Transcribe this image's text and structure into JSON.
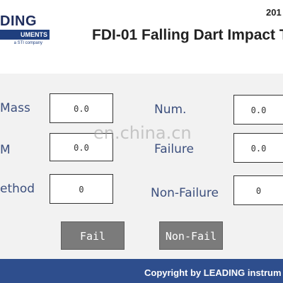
{
  "header": {
    "logo_line1": "DING",
    "logo_band": "UMENTS",
    "logo_sub": "a STI company",
    "date": "201",
    "title": "FDI-01 Falling Dart Impact T"
  },
  "form": {
    "mass_label": "Mass",
    "mass_value": "0.0",
    "m_label": "M",
    "m_value": "0.0",
    "method_label": "ethod",
    "method_value": "0",
    "num_label": "Num.",
    "num_value": "0.0",
    "failure_label": "Failure",
    "failure_value": "0.0",
    "nonfailure_label": "Non-Failure",
    "nonfailure_value": "0"
  },
  "buttons": {
    "fail": "Fail",
    "nonfail": "Non-Fail"
  },
  "watermark": "en.china.cn",
  "footer": {
    "copyright": "Copyright by LEADING instrum"
  },
  "colors": {
    "footer_bg": "#2e4e8d",
    "label_color": "#3c4f7d",
    "button_bg": "#7b7b7b"
  }
}
